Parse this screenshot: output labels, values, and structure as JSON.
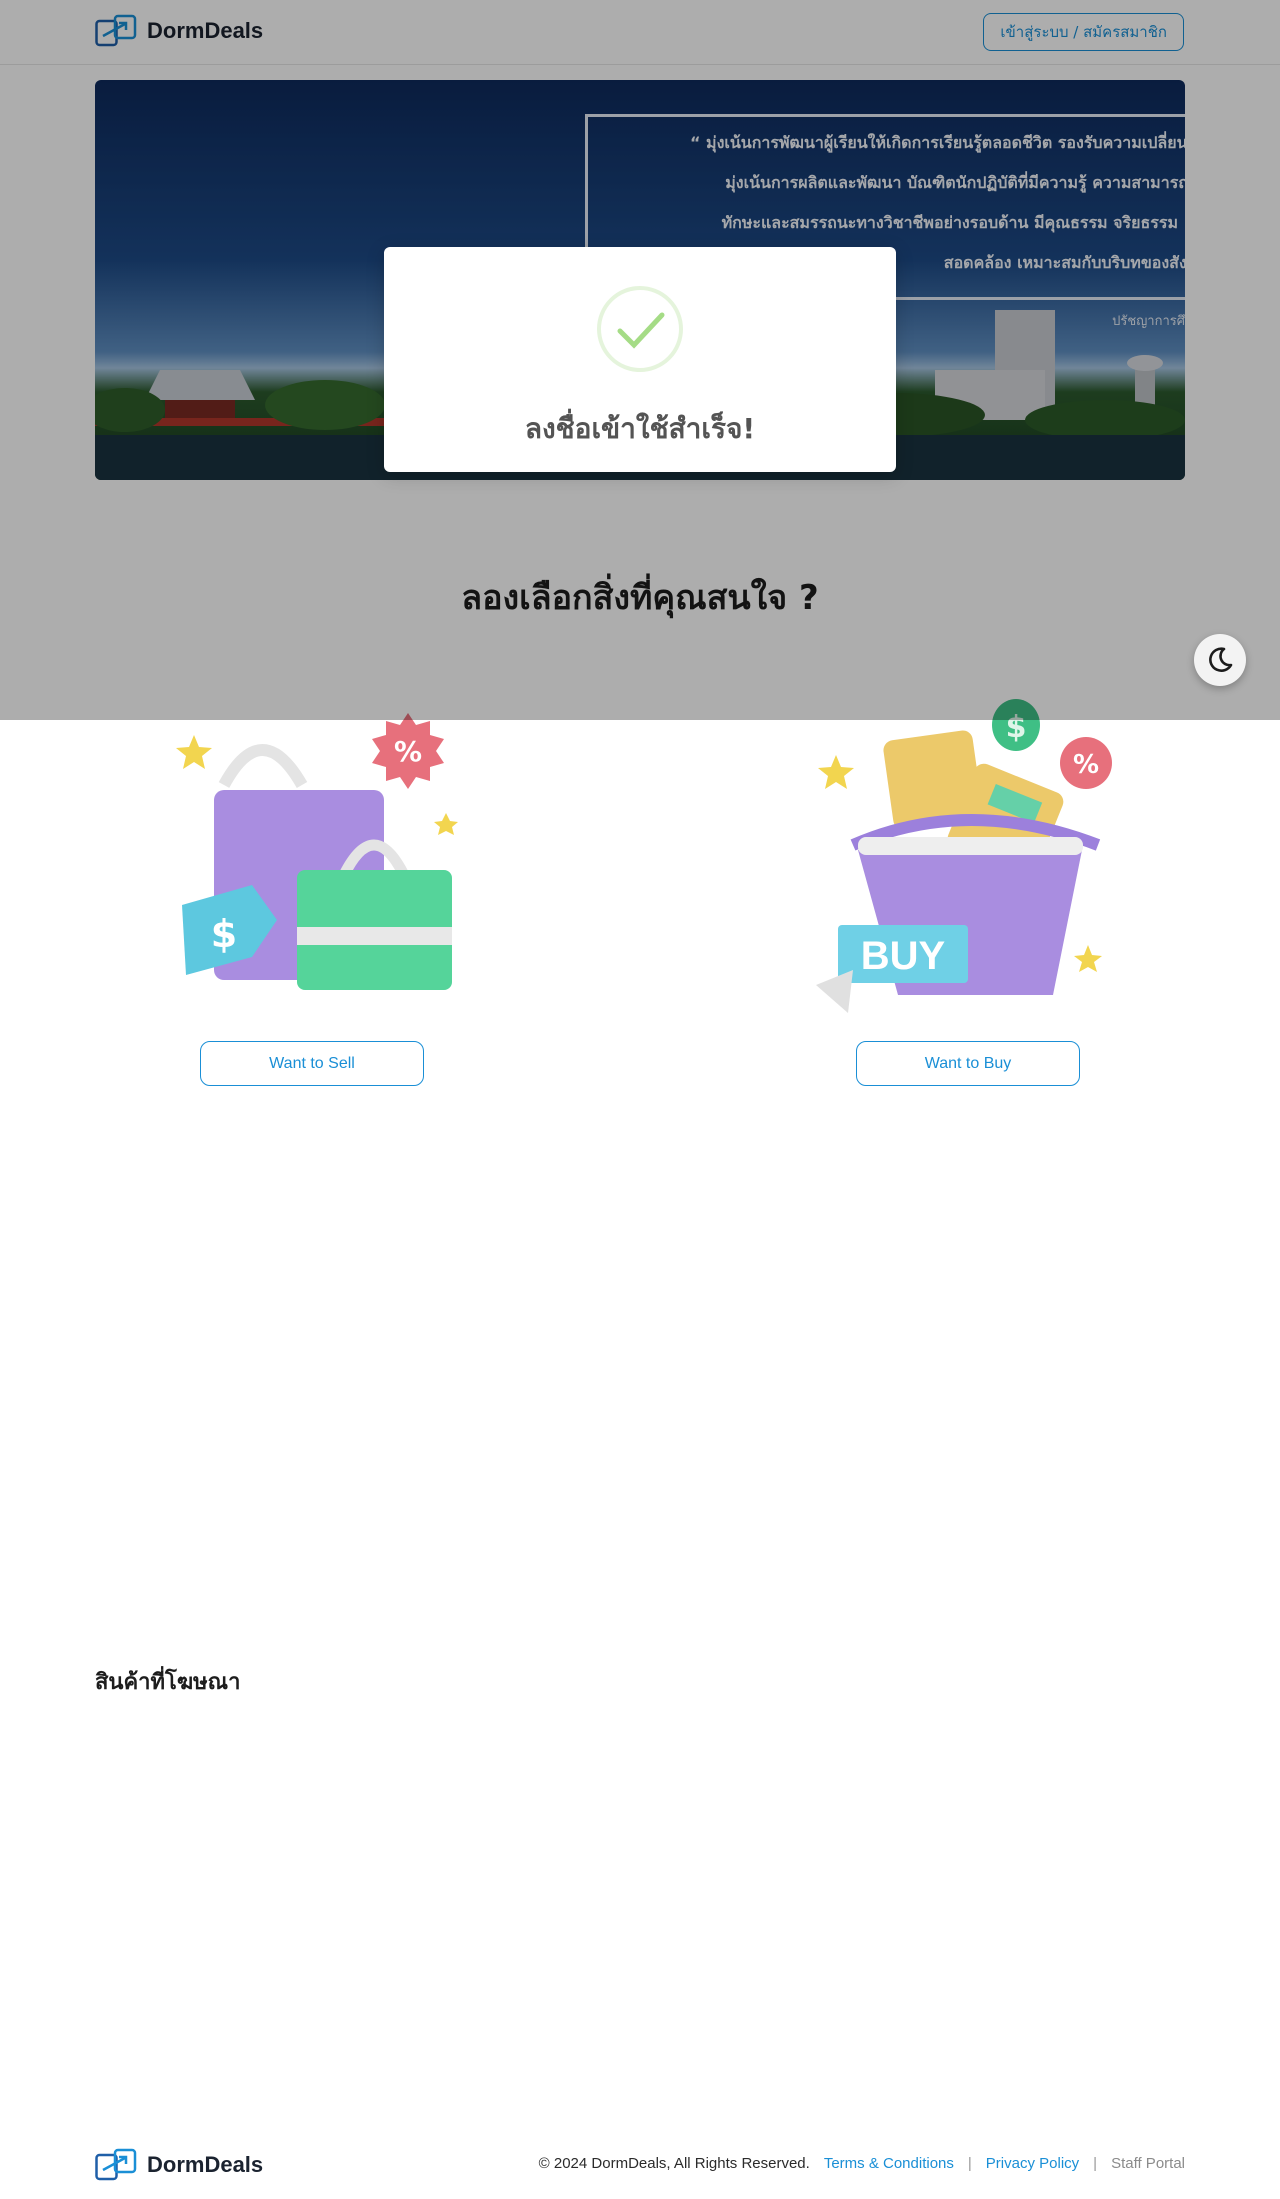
{
  "header": {
    "brand": "DormDeals",
    "login_label": "เข้าสู่ระบบ / สมัครสมาชิก"
  },
  "hero": {
    "motto_lines": [
      "“ มุ่งเน้นการพัฒนาผู้เรียนให้เกิดการเรียนรู้ตลอดชีวิต รองรับความเปลี่ยนแป",
      "มุ่งเน้นการผลิตและพัฒนา บัณฑิตนักปฏิบัติที่มีความรู้ ความสามารถ",
      "ทักษะและสมรรถนะทางวิชาชีพอย่างรอบด้าน มีคุณธรรม จริยธรรม",
      "สอดคล้อง เหมาะสมกับบริบทของสังคม"
    ],
    "credit": "ปรัชญาการศึ"
  },
  "modal": {
    "title": "ลงชื่อเข้าใช้สำเร็จ!"
  },
  "main": {
    "section_title": "ลองเลือกสิ่งที่คุณสนใจ ?",
    "sell_label": "Want to Sell",
    "buy_label": "Want to Buy",
    "buy_badge": "BUY",
    "ads_title": "สินค้าที่โฆษณา"
  },
  "footer": {
    "brand": "DormDeals",
    "copyright": "© 2024 DormDeals, All Rights Reserved.",
    "terms": "Terms & Conditions",
    "privacy": "Privacy Policy",
    "staff": "Staff Portal",
    "separator": "|"
  },
  "colors": {
    "accent": "#1a8fd6",
    "success": "#a5dc86"
  },
  "icons": {
    "logo": "dormdeals-logo-icon",
    "dark_mode": "moon-icon",
    "success": "check-circle-icon"
  }
}
